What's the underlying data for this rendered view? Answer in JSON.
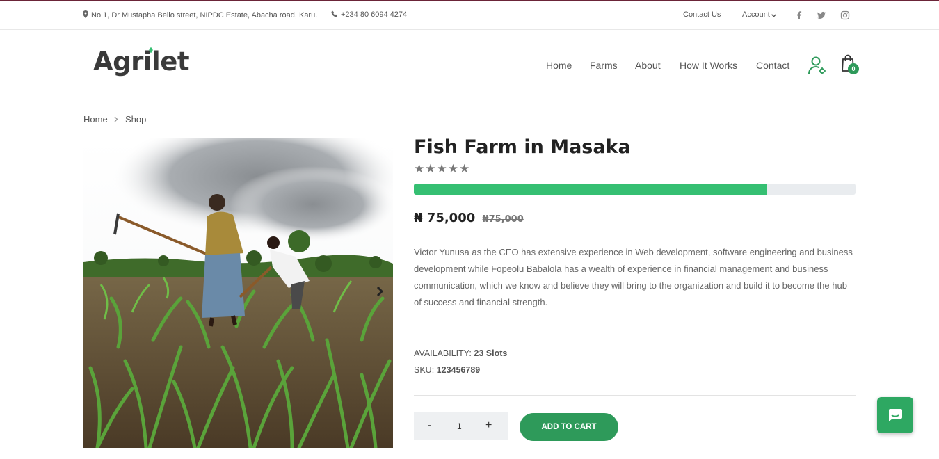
{
  "topbar": {
    "address": "No 1, Dr Mustapha Bello street, NIPDC Estate, Abacha road, Karu.",
    "phone": "+234 80 6094 4274",
    "contact_us": "Contact Us",
    "account": "Account",
    "social": [
      "facebook-icon",
      "twitter-icon",
      "instagram-icon"
    ]
  },
  "header": {
    "logo": "Agrilet",
    "nav": [
      "Home",
      "Farms",
      "About",
      "How It Works",
      "Contact"
    ],
    "cart_count": "0"
  },
  "breadcrumb": [
    "Home",
    "Shop"
  ],
  "product": {
    "title": "Fish Farm in Masaka",
    "rating": "★★★★★",
    "funding_progress_fraction": 0.8,
    "price": "₦ 75,000",
    "old_price": "₦75,000",
    "description": "Victor Yunusa as the CEO has extensive experience in Web development, software engineering and business development while Fopeolu Babalola has a wealth of experience in financial management and business communication, which we know and believe they will bring to the organization and build it to become the hub of success and financial strength.",
    "availability_label": "AVAILABILITY:",
    "availability_value": "23 Slots",
    "sku_label": "SKU:",
    "sku_value": "123456789",
    "qty_minus": "-",
    "qty_value": "1",
    "qty_plus": "+",
    "add_to_cart": "ADD TO CART"
  },
  "colors": {
    "brand_green": "#2e9a5a",
    "progress_green": "#35bf72",
    "topbar_accent": "#6b2438"
  }
}
